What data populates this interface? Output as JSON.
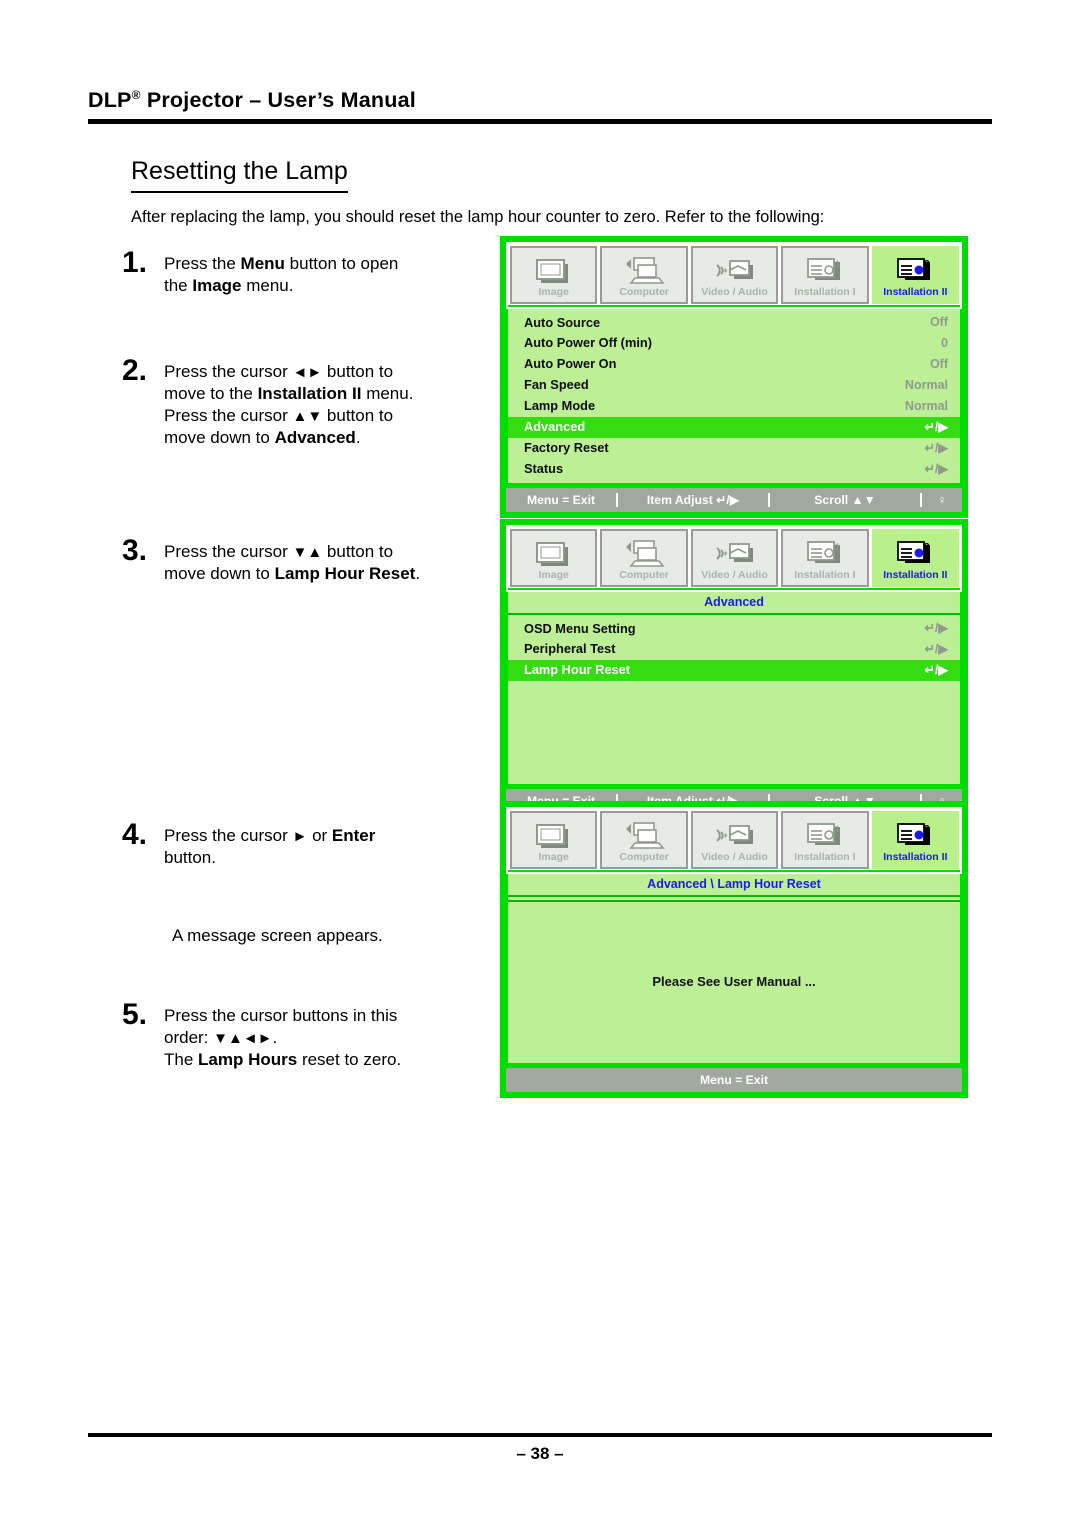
{
  "header": {
    "title_main": "DLP",
    "title_sup": "®",
    "title_rest": " Projector – User’s Manual"
  },
  "section": {
    "heading": "Resetting the Lamp",
    "intro": "After replacing the lamp, you should reset the lamp hour counter to zero. Refer to the following:"
  },
  "steps": [
    {
      "number": "1.",
      "line1_a": "Press the ",
      "line1_b": "Menu",
      "line1_c": " button to open",
      "line2_a": "the ",
      "line2_b": "Image",
      "line2_c": " menu."
    },
    {
      "number": "2.",
      "line1_a": "Press the cursor ",
      "line1_arrows": "◄►",
      "line1_c": " button to",
      "line2_a": "move to the ",
      "line2_b": "Installation II",
      "line2_c": " menu.",
      "line3_a": "Press the cursor ",
      "line3_arrows": "▲▼",
      "line3_c": " button to",
      "line4_a": "move down to ",
      "line4_b": "Advanced",
      "line4_c": "."
    },
    {
      "number": "3.",
      "line1_a": "Press the cursor ",
      "line1_arrows": "▼▲",
      "line1_c": " button to",
      "line2_a": "move down to ",
      "line2_b": "Lamp Hour Reset",
      "line2_c": "."
    },
    {
      "number": "4.",
      "line1_a": "Press the cursor ",
      "line1_arrows": "►",
      "line1_c": " or ",
      "line1_d": "Enter",
      "line2_a": "button."
    },
    {
      "number": "5.",
      "line1_a": "Press the cursor buttons in this",
      "line2_a": "order: ",
      "line2_arrows": "▼▲◄►",
      "line2_c": ".",
      "line3_a": "The ",
      "line3_b": "Lamp Hours",
      "line3_c": " reset to zero."
    }
  ],
  "note": {
    "message_screen": "A message screen appears."
  },
  "osd_tabs": [
    {
      "label": "Image",
      "icon": "screen-icon",
      "active": false
    },
    {
      "label": "Computer",
      "icon": "laptop-icon",
      "active": false
    },
    {
      "label": "Video / Audio",
      "icon": "video-audio-icon",
      "active": false
    },
    {
      "label": "Installation I",
      "icon": "install-one-icon",
      "active": false
    },
    {
      "label": "Installation II",
      "icon": "install-two-icon",
      "active": true
    }
  ],
  "osd1": {
    "rows": [
      {
        "label": "Auto Source",
        "value": "Off",
        "selected": false
      },
      {
        "label": "Auto Power Off (min)",
        "value": "0",
        "selected": false
      },
      {
        "label": "Auto Power On",
        "value": "Off",
        "selected": false
      },
      {
        "label": "Fan Speed",
        "value": "Normal",
        "selected": false
      },
      {
        "label": "Lamp Mode",
        "value": "Normal",
        "selected": false
      },
      {
        "label": "Advanced",
        "value": "↵/▶",
        "selected": true
      },
      {
        "label": "Factory Reset",
        "value": "↵/▶",
        "selected": false
      },
      {
        "label": "Status",
        "value": "↵/▶",
        "selected": false
      }
    ],
    "footer": {
      "exit": "Menu = Exit",
      "adjust": "Item Adjust ↵/▶",
      "scroll": "Scroll ▲▼",
      "lamp": "♀"
    }
  },
  "osd2": {
    "subtitle": "Advanced",
    "rows": [
      {
        "label": "OSD Menu Setting",
        "value": "↵/▶",
        "selected": false
      },
      {
        "label": "Peripheral Test",
        "value": "↵/▶",
        "selected": false
      },
      {
        "label": "Lamp Hour Reset",
        "value": "↵/▶",
        "selected": true
      }
    ],
    "footer": {
      "exit": "Menu = Exit",
      "adjust": "Item Adjust ↵/▶",
      "scroll": "Scroll ▲▼",
      "lamp": "♀"
    }
  },
  "osd3": {
    "subtitle": "Advanced \\ Lamp Hour Reset",
    "message": "Please See User Manual ...",
    "footer": {
      "exit": "Menu = Exit"
    }
  },
  "footer": {
    "page_number": "– 38 –"
  },
  "colors": {
    "osd_border": "#00dd00",
    "osd_body": "#bdf096",
    "osd_selected": "#33dd11",
    "osd_footer": "#a0a8a0",
    "tab_active_label": "#1a1af0",
    "tab_inactive_label": "#a9b3a9"
  }
}
